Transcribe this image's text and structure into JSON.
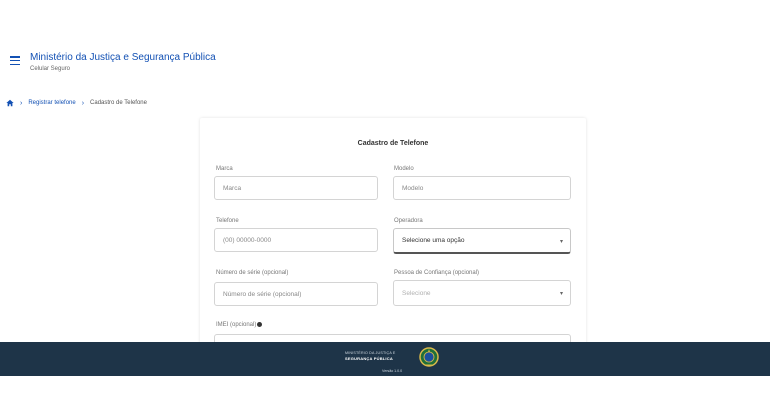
{
  "header": {
    "title": "Ministério da Justiça e Segurança Pública",
    "subtitle": "Celular Seguro"
  },
  "breadcrumb": {
    "items": [
      "Registrar telefone",
      "Cadastro de Telefone"
    ]
  },
  "form": {
    "title": "Cadastro de Telefone",
    "fields": {
      "marca": {
        "label": "Marca",
        "placeholder": "Marca"
      },
      "modelo": {
        "label": "Modelo",
        "placeholder": "Modelo"
      },
      "telefone": {
        "label": "Telefone",
        "placeholder": "(00) 00000-0000"
      },
      "operadora": {
        "label": "Operadora",
        "value": "Selecione uma opção"
      },
      "serie": {
        "label": "Número de série (opcional)",
        "placeholder": "Número de série (opcional)"
      },
      "confianca": {
        "label": "Pessoa de Confiança (opcional)",
        "value": "Selecione"
      },
      "imei": {
        "label": "IMEI (opcional)"
      }
    }
  },
  "footer": {
    "line1": "MINISTÉRIO DA JUSTIÇA E",
    "line2": "SEGURANÇA PÚBLICA",
    "line3": "Versão 1.0.0"
  },
  "colors": {
    "primary": "#1351b4",
    "footer_bg": "#1e3448"
  },
  "icons": {
    "menu": "menu-icon",
    "home": "home-icon",
    "chevron": "chevron-down-icon",
    "info": "info-icon",
    "coat_of_arms": "coat-of-arms-icon"
  }
}
